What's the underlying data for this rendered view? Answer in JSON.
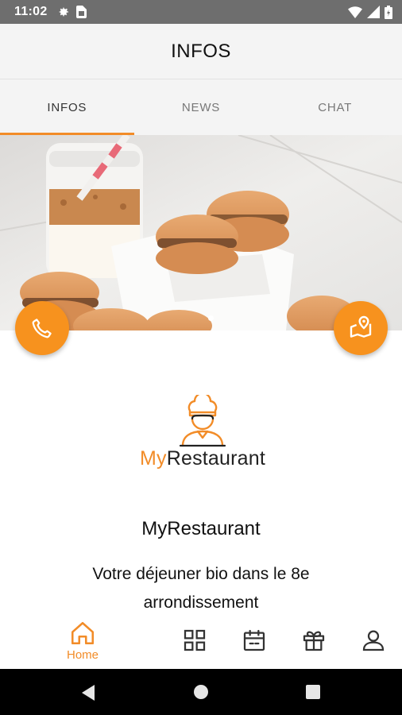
{
  "status_bar": {
    "time": "11:02",
    "left_icons": [
      "settings-icon",
      "sim-card-icon"
    ],
    "right_icons": [
      "wifi-icon",
      "signal-icon",
      "battery-icon"
    ]
  },
  "app_bar": {
    "title": "INFOS"
  },
  "tabs": [
    {
      "label": "INFOS",
      "active": true
    },
    {
      "label": "NEWS",
      "active": false
    },
    {
      "label": "CHAT",
      "active": false
    }
  ],
  "hero": {
    "subject": "macarons-photo",
    "carousel_pages": 1,
    "carousel_active": 1
  },
  "actions": {
    "call_icon": "phone-icon",
    "map_icon": "map-pin-icon"
  },
  "logo": {
    "word_first": "My",
    "word_second": "Restaurant",
    "icon": "chef-icon"
  },
  "restaurant": {
    "name": "MyRestaurant",
    "description": "Votre déjeuner bio dans le 8e arrondissement"
  },
  "bottom_nav": [
    {
      "label": "Home",
      "icon": "home-icon",
      "active": true
    },
    {
      "label": "",
      "icon": "grid-icon",
      "active": false
    },
    {
      "label": "",
      "icon": "calendar-icon",
      "active": false
    },
    {
      "label": "",
      "icon": "gift-icon",
      "active": false
    },
    {
      "label": "",
      "icon": "user-icon",
      "active": false
    }
  ],
  "colors": {
    "accent": "#f28c28",
    "fab": "#f7921e",
    "status_bar": "#6e6e6e",
    "app_bar": "#f4f4f4"
  }
}
